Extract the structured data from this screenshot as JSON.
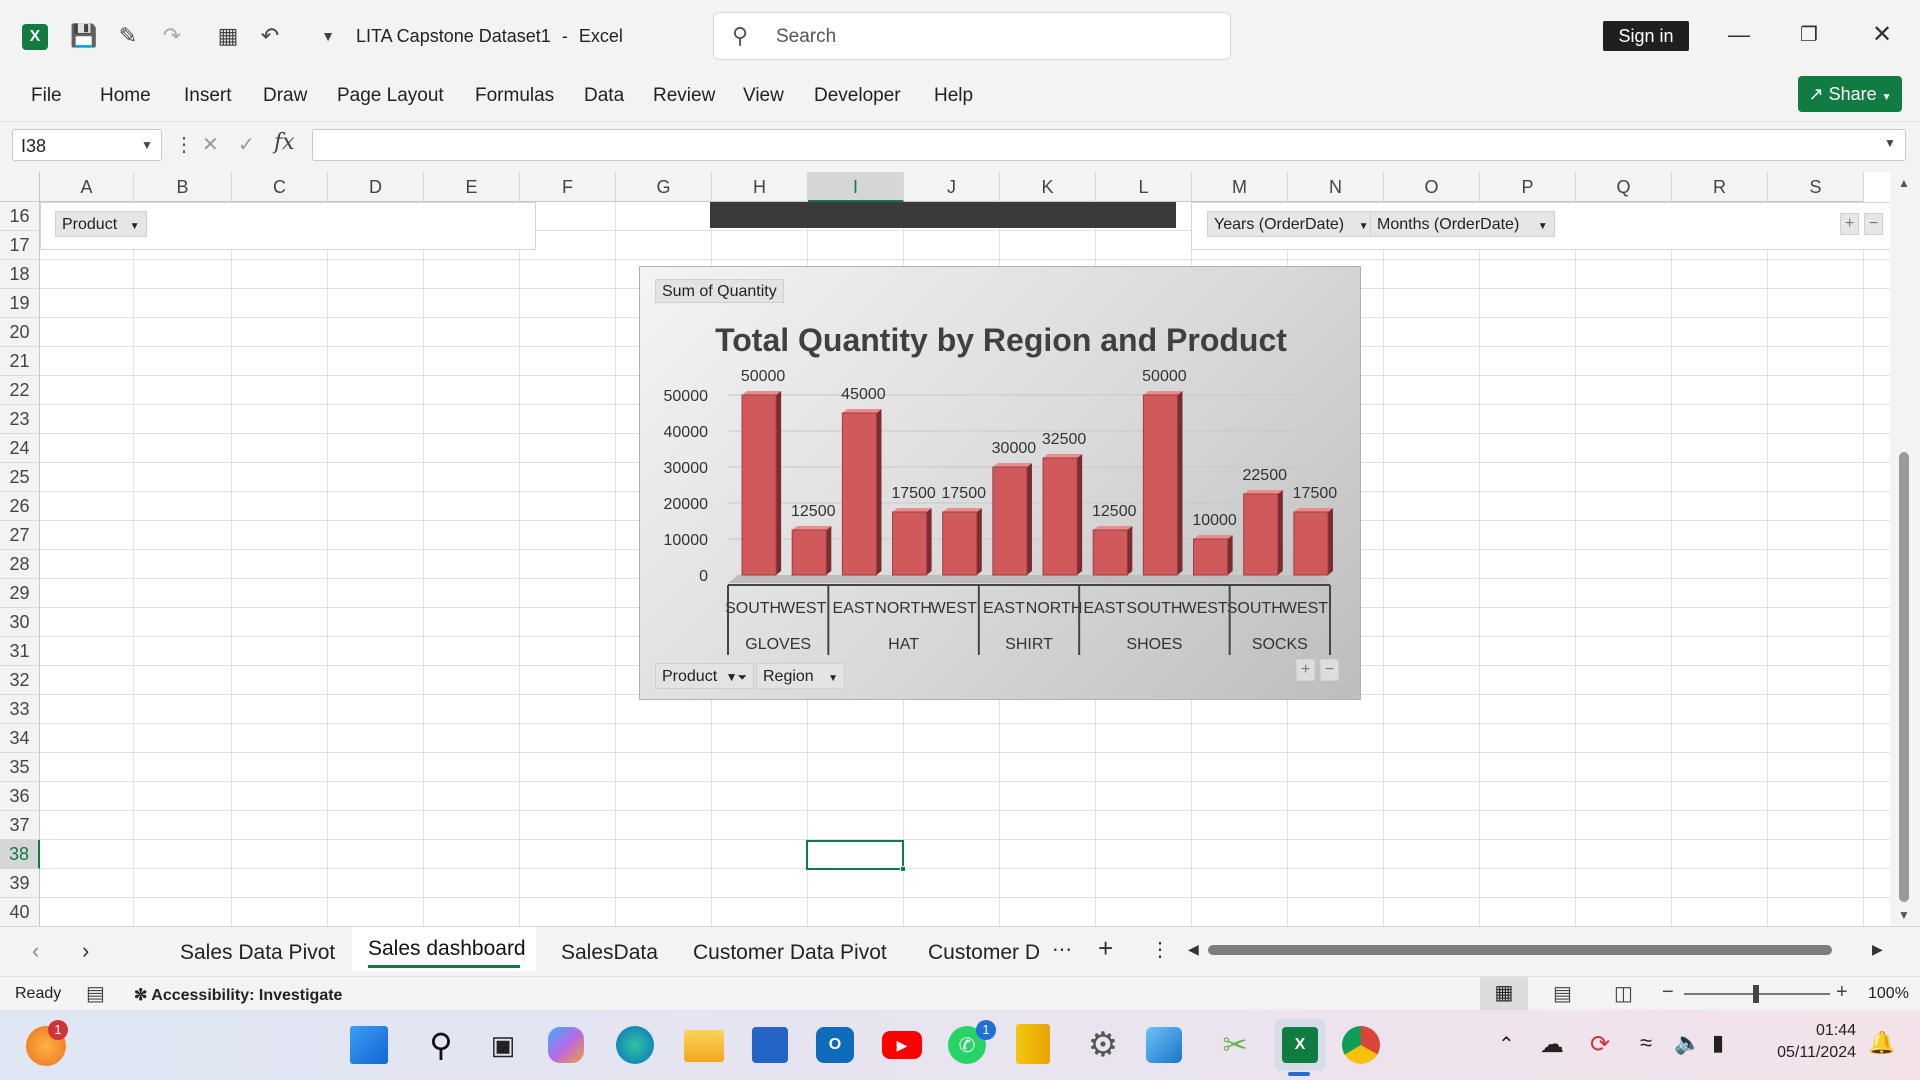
{
  "app": {
    "doc_title": "LITA Capstone Dataset1",
    "app_name": "Excel",
    "title_sep": "-",
    "search_placeholder": "Search",
    "sign_in": "Sign in",
    "share": "Share"
  },
  "menu": [
    "File",
    "Home",
    "Insert",
    "Draw",
    "Page Layout",
    "Formulas",
    "Data",
    "Review",
    "View",
    "Developer",
    "Help"
  ],
  "formula_bar": {
    "name_box": "I38",
    "cancel": "✕",
    "enter": "✓",
    "fx": "fx",
    "formula": ""
  },
  "columns": [
    "A",
    "B",
    "C",
    "D",
    "E",
    "F",
    "G",
    "H",
    "I",
    "J",
    "K",
    "L",
    "M",
    "N",
    "O",
    "P",
    "Q",
    "R",
    "S"
  ],
  "rows": [
    "16",
    "17",
    "18",
    "19",
    "20",
    "21",
    "22",
    "23",
    "24",
    "25",
    "26",
    "27",
    "28",
    "29",
    "30",
    "31",
    "32",
    "33",
    "34",
    "35",
    "36",
    "37",
    "38",
    "39",
    "40"
  ],
  "selected_cell": "I38",
  "slicers": {
    "product": "Product",
    "years": "Years (OrderDate)",
    "months": "Months (OrderDate)"
  },
  "pivot_chart": {
    "value_field": "Sum of Quantity",
    "product_btn": "Product",
    "region_btn": "Region",
    "plus": "+",
    "minus": "−"
  },
  "chart_data": {
    "type": "bar",
    "title": "Total Quantity by Region and Product",
    "ylim": [
      0,
      50000
    ],
    "yticks": [
      "0",
      "10000",
      "20000",
      "30000",
      "40000",
      "50000"
    ],
    "categories": [
      "SOUTH",
      "WEST",
      "EAST",
      "NORTH",
      "WEST",
      "EAST",
      "NORTH",
      "EAST",
      "SOUTH",
      "WEST",
      "SOUTH",
      "WEST"
    ],
    "groups": [
      {
        "label": "GLOVES",
        "count": 2
      },
      {
        "label": "HAT",
        "count": 3
      },
      {
        "label": "SHIRT",
        "count": 2
      },
      {
        "label": "SHOES",
        "count": 3
      },
      {
        "label": "SOCKS",
        "count": 2
      }
    ],
    "values": [
      50000,
      12500,
      45000,
      17500,
      17500,
      30000,
      32500,
      12500,
      50000,
      10000,
      22500,
      17500
    ],
    "data_labels": [
      "50000",
      "12500",
      "45000",
      "17500",
      "17500",
      "30000",
      "32500",
      "12500",
      "50000",
      "10000",
      "22500",
      "17500"
    ],
    "colors": {
      "bar": "#d0595b",
      "bar_dark": "#7a2d30",
      "bar_light": "#e88c8c"
    }
  },
  "sheet_tabs": [
    "Sales Data Pivot",
    "Sales dashboard",
    "SalesData",
    "Customer Data Pivot",
    "Customer D"
  ],
  "active_tab": "Sales dashboard",
  "status": {
    "ready": "Ready",
    "accessibility": "Accessibility: Investigate",
    "zoom": "100%"
  },
  "taskbar": {
    "time": "01:44",
    "date": "05/11/2024",
    "whatsapp_badge": "1",
    "app_badge": "1"
  },
  "colors": {
    "excel_green": "#107c41",
    "accent": "#1e7145"
  }
}
